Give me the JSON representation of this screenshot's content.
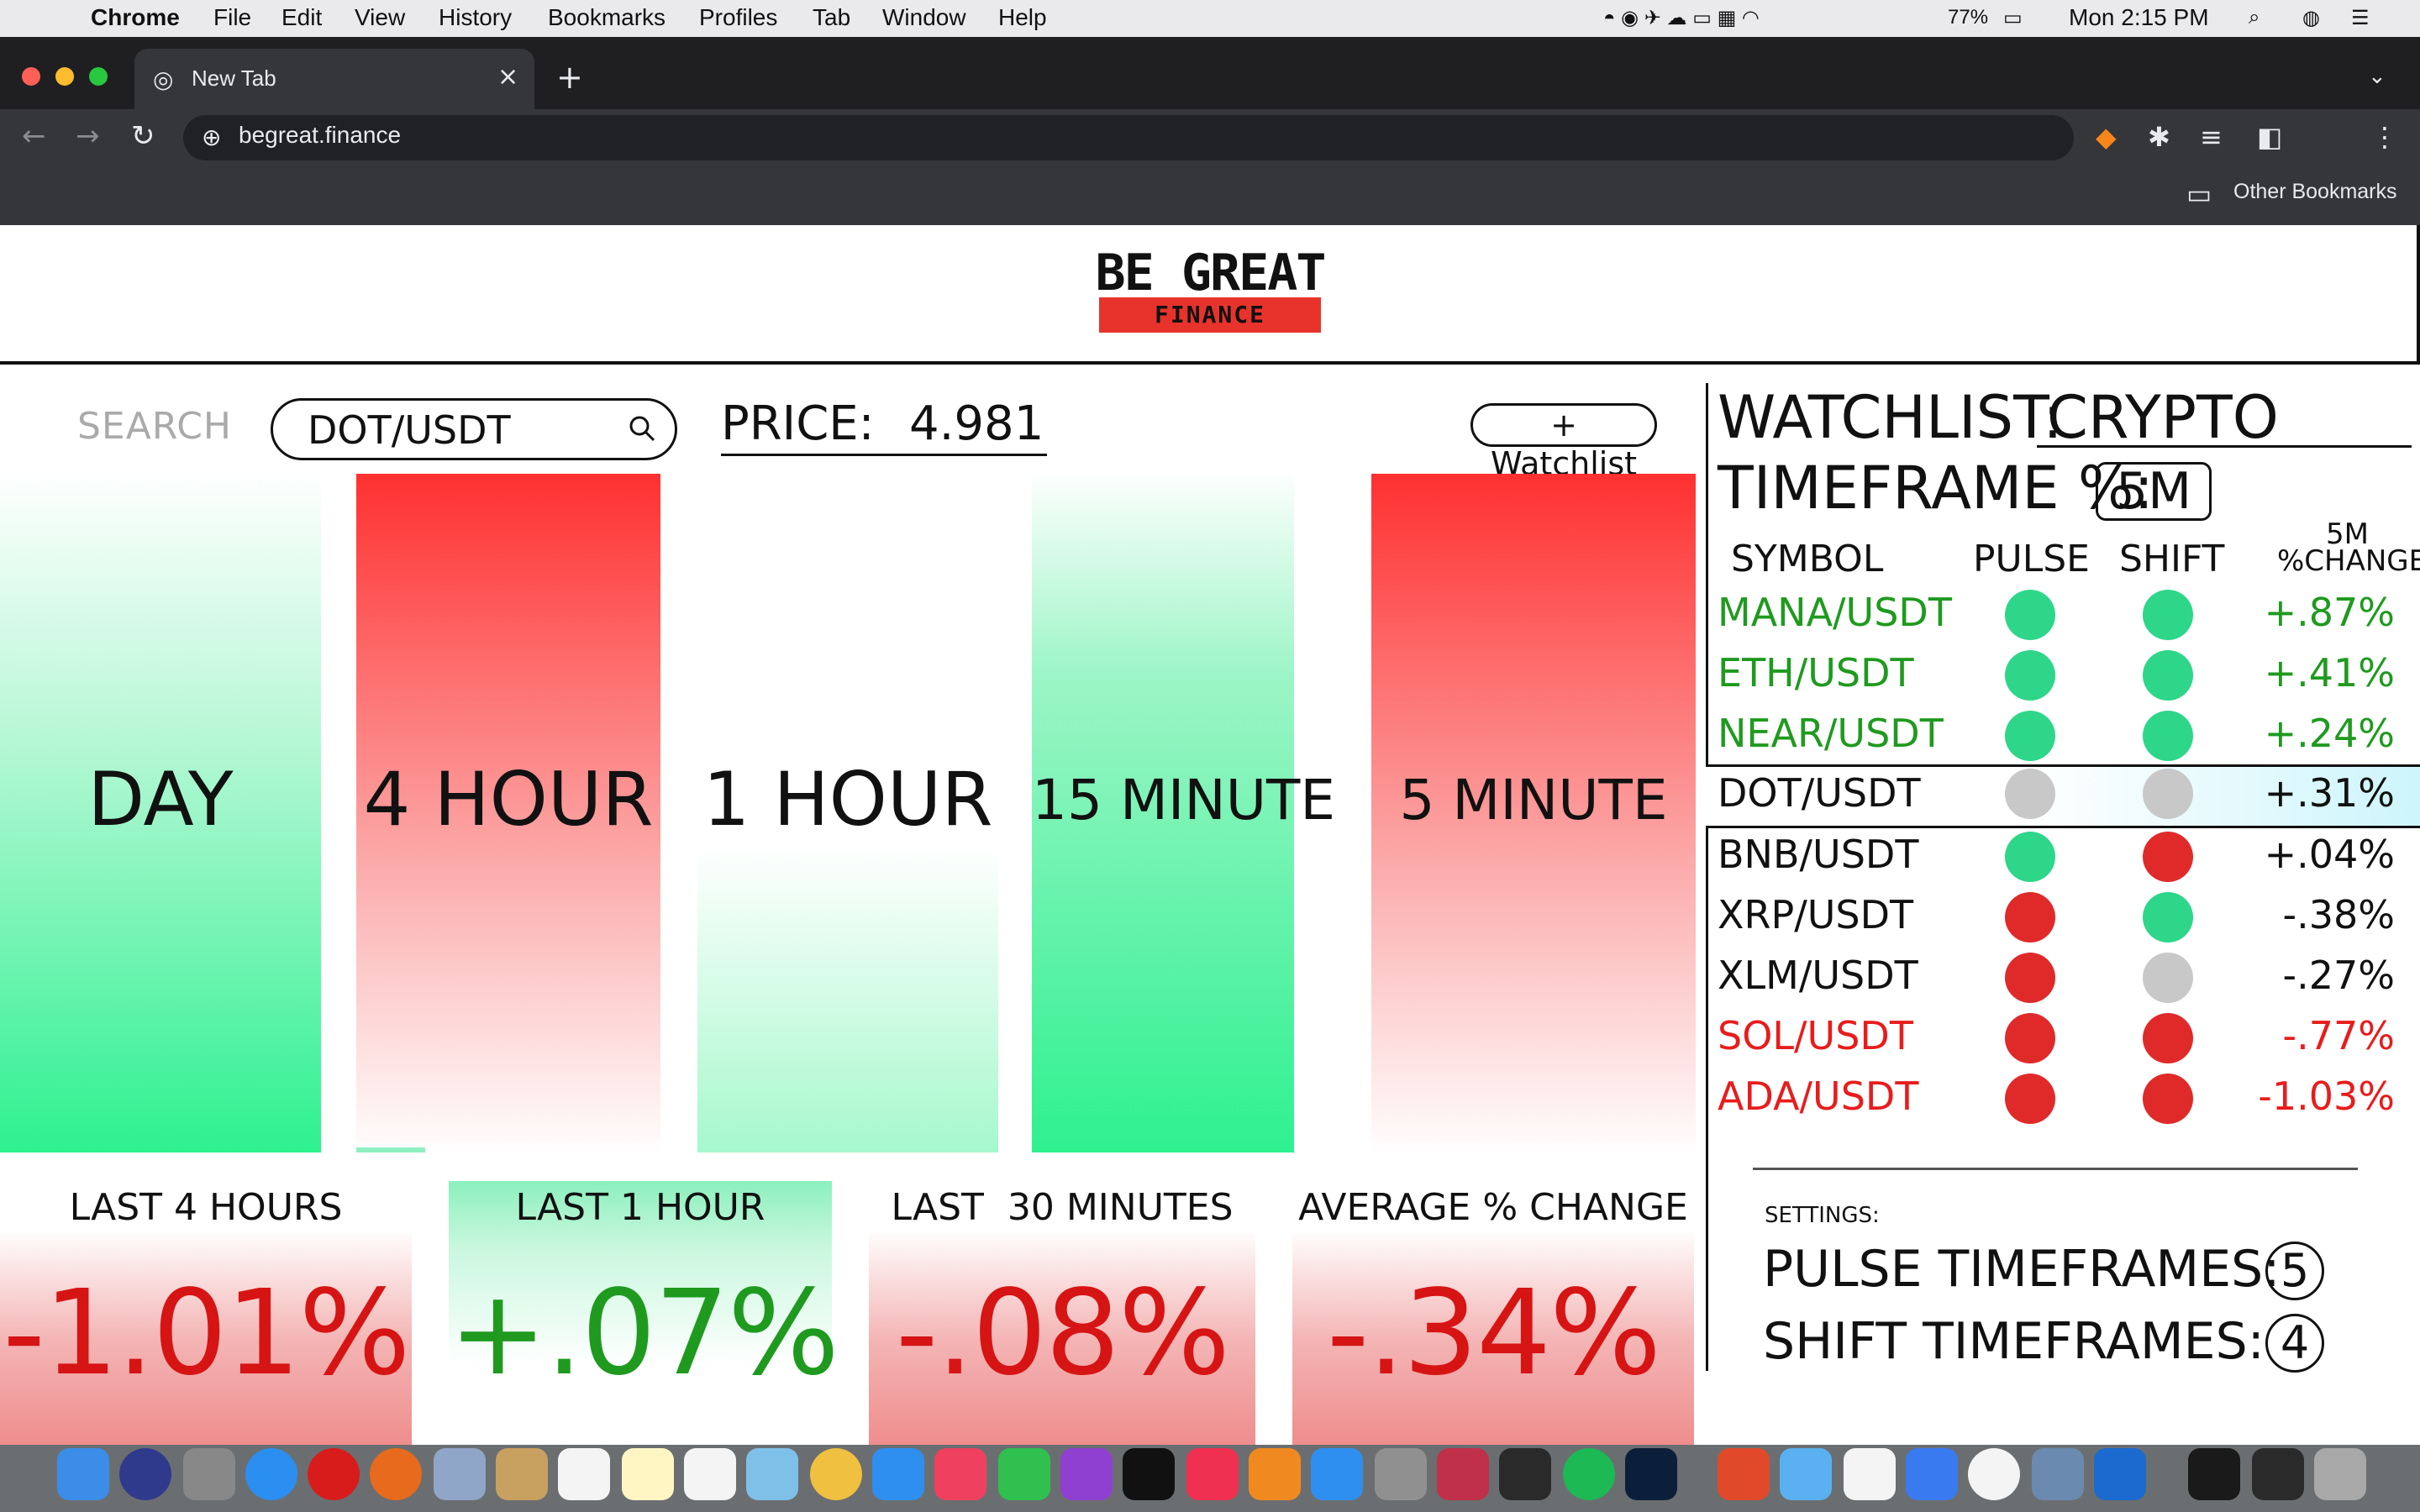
{
  "menubar": {
    "app": "Chrome",
    "items": [
      "File",
      "Edit",
      "View",
      "History",
      "Bookmarks",
      "Profiles",
      "Tab",
      "Window",
      "Help"
    ],
    "battery": "77%",
    "clock": "Mon 2:15 PM"
  },
  "browser": {
    "tab_title": "New Tab",
    "url": "begreat.finance",
    "bookmarks_folder": "Other Bookmarks"
  },
  "logo": {
    "title": "BE GREAT",
    "subtitle": "FINANCE"
  },
  "search": {
    "label": "SEARCH",
    "value": "DOT/USDT"
  },
  "price": {
    "label": "PRICE:",
    "value": "4.981"
  },
  "watchlist_button": "+ Watchlist",
  "timeframe_bars": [
    {
      "label": "DAY",
      "trend": "up"
    },
    {
      "label": "4 HOUR",
      "trend": "down"
    },
    {
      "label": "1 HOUR",
      "trend": "up"
    },
    {
      "label": "15 MINUTE",
      "trend": "up"
    },
    {
      "label": "5 MINUTE",
      "trend": "down"
    }
  ],
  "stats": [
    {
      "label": "LAST 4 HOURS",
      "value": "-1.01%",
      "color": "#d61414"
    },
    {
      "label": "LAST 1 HOUR",
      "value": "+.07%",
      "color": "#1f9a1f"
    },
    {
      "label": "LAST  30 MINUTES",
      "value": "-.08%",
      "color": "#d61414"
    },
    {
      "label": "AVERAGE % CHANGE",
      "value": "-.34%",
      "color": "#d61414"
    }
  ],
  "watchlist": {
    "title": "WATCHLIST:",
    "list_name": "CRYPTO",
    "timeframe_label": "TIMEFRAME %:",
    "timeframe_value": "5M",
    "headers": {
      "symbol": "SYMBOL",
      "pulse": "PULSE",
      "shift": "SHIFT",
      "change_top": "5M",
      "change_bottom": "%CHANGE"
    },
    "rows": [
      {
        "symbol": "MANA/USDT",
        "pulse": "green",
        "shift": "green",
        "change": "+.87%",
        "color": "#1f9a1f"
      },
      {
        "symbol": "ETH/USDT",
        "pulse": "green",
        "shift": "green",
        "change": "+.41%",
        "color": "#1f9a1f"
      },
      {
        "symbol": "NEAR/USDT",
        "pulse": "green",
        "shift": "green",
        "change": "+.24%",
        "color": "#1f9a1f"
      },
      {
        "symbol": "DOT/USDT",
        "pulse": "gray",
        "shift": "gray",
        "change": "+.31%",
        "color": "#111111",
        "selected": true
      },
      {
        "symbol": "BNB/USDT",
        "pulse": "green",
        "shift": "red",
        "change": "+.04%",
        "color": "#111111"
      },
      {
        "symbol": "XRP/USDT",
        "pulse": "red",
        "shift": "green",
        "change": "-.38%",
        "color": "#111111"
      },
      {
        "symbol": "XLM/USDT",
        "pulse": "red",
        "shift": "gray",
        "change": "-.27%",
        "color": "#111111"
      },
      {
        "symbol": "SOL/USDT",
        "pulse": "red",
        "shift": "red",
        "change": "-.77%",
        "color": "#e81c1c"
      },
      {
        "symbol": "ADA/USDT",
        "pulse": "red",
        "shift": "red",
        "change": "-1.03%",
        "color": "#e81c1c"
      }
    ]
  },
  "settings": {
    "label": "SETTINGS:",
    "pulse_label": "PULSE TIMEFRAMES:",
    "pulse_value": "5",
    "shift_label": "SHIFT TIMEFRAMES:",
    "shift_value": "4"
  }
}
